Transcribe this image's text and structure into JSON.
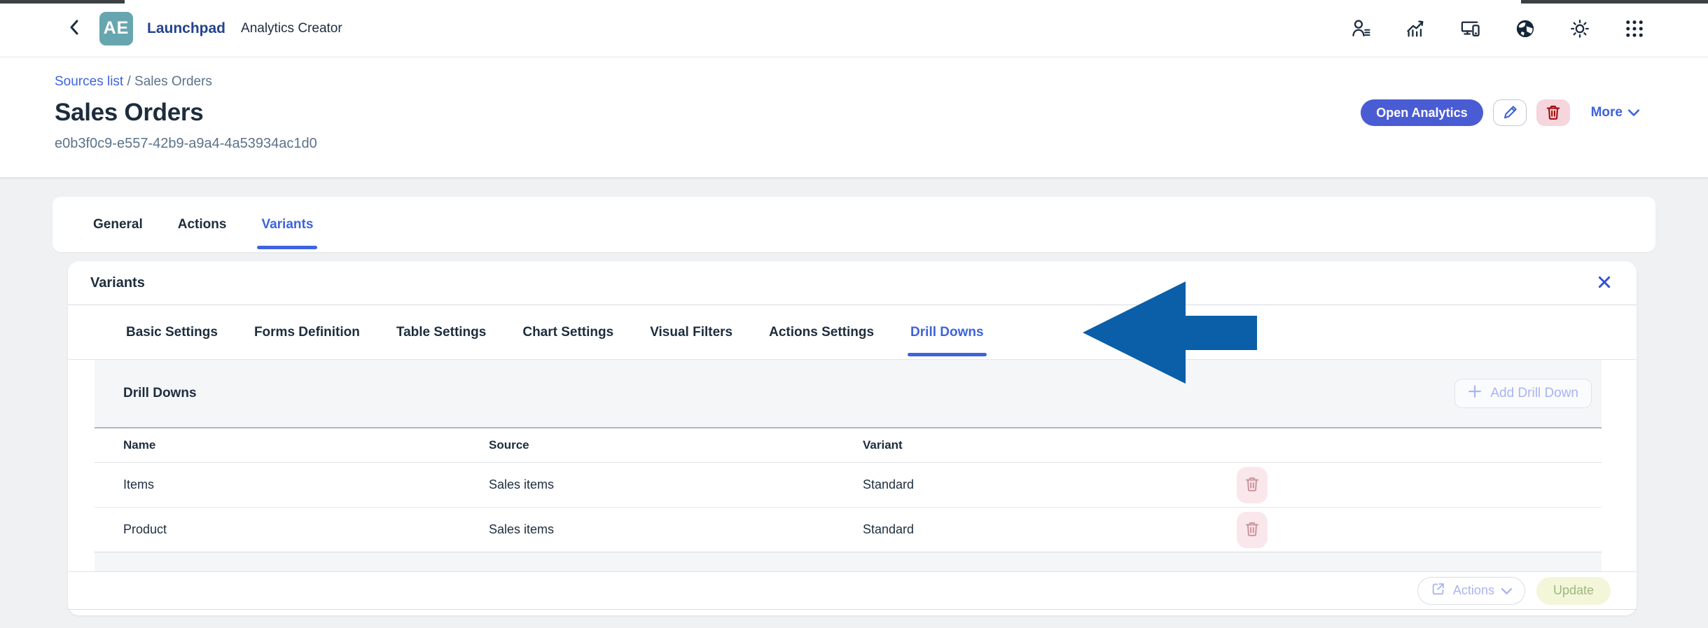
{
  "topbar": {
    "logo_text": "AE",
    "app_title": "Launchpad",
    "app_subtitle": "Analytics Creator",
    "icons": [
      "back-icon",
      "user-settings-icon",
      "trend-chart-icon",
      "devices-icon",
      "globe-icon",
      "sun-icon",
      "grid-menu-icon"
    ]
  },
  "header": {
    "breadcrumb": {
      "link": "Sources list",
      "separator": " / ",
      "current": "Sales Orders"
    },
    "title": "Sales Orders",
    "subtitle": "e0b3f0c9-e557-42b9-a9a4-4a53934ac1d0",
    "open_analytics_label": "Open Analytics",
    "more_label": "More",
    "icon_buttons": [
      "edit-pencil-icon",
      "delete-trash-icon"
    ]
  },
  "main_tabs": {
    "items": [
      {
        "label": "General",
        "active": false
      },
      {
        "label": "Actions",
        "active": false
      },
      {
        "label": "Variants",
        "active": true
      }
    ]
  },
  "variants_panel": {
    "title": "Variants",
    "close_icon": "close-x-icon",
    "tabs": [
      "Basic Settings",
      "Forms Definition",
      "Table Settings",
      "Chart Settings",
      "Visual Filters",
      "Actions Settings",
      "Drill Downs"
    ],
    "active_tab": "Drill Downs",
    "section": {
      "title": "Drill Downs",
      "add_button_label": "Add Drill Down"
    },
    "table": {
      "columns": [
        "Name",
        "Source",
        "Variant"
      ],
      "rows": [
        {
          "name": "Items",
          "source": "Sales items",
          "variant": "Standard"
        },
        {
          "name": "Product",
          "source": "Sales items",
          "variant": "Standard"
        }
      ]
    },
    "footer": {
      "actions_label": "Actions",
      "update_label": "Update"
    }
  },
  "annotation": {
    "type": "left-pointing-arrow",
    "target": "Drill Downs tab",
    "color": "#0a5fa8"
  },
  "colors": {
    "accent_blue": "#3e63dd",
    "primary_button": "#4a5cd4",
    "logo_teal": "#68a6af",
    "app_title_blue": "#24428e",
    "danger_dark_red": "#a40a0a",
    "danger_pill_pink": "#f6d5dd",
    "row_delete_pink": "#f9e7ec",
    "disabled_periwinkle": "#a9b4f2",
    "update_disabled_bg": "#f3f6d9",
    "update_disabled_text": "#9eb87c",
    "arrow_blue": "#0a5fa8",
    "text_dark": "#1d2d3e",
    "text_gray": "#5b738b",
    "page_bg": "#eff1f3"
  }
}
